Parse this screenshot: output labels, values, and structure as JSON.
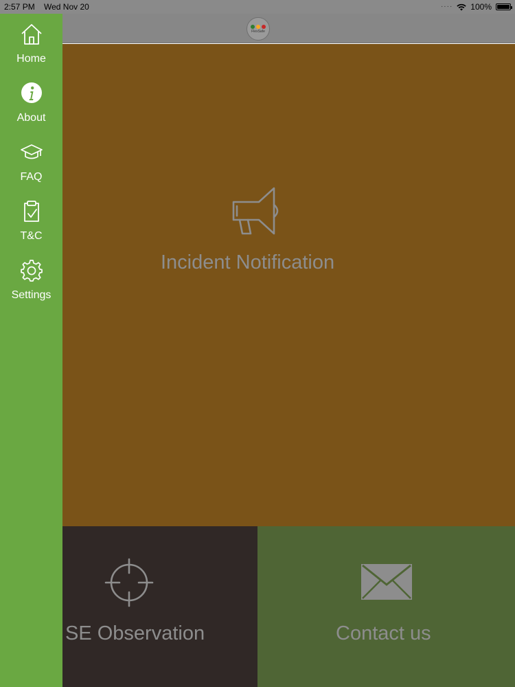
{
  "status_bar": {
    "time": "2:57 PM",
    "date": "Wed Nov 20",
    "battery": "100%",
    "signal_dots": "····"
  },
  "header": {
    "logo_text": "FlexSafe",
    "logo_colors": [
      "#2e7d32",
      "#f9a825",
      "#c62828"
    ]
  },
  "sidebar": {
    "background": "#6aa842",
    "items": [
      {
        "label": "Home",
        "icon": "home-icon"
      },
      {
        "label": "About",
        "icon": "info-icon"
      },
      {
        "label": "FAQ",
        "icon": "graduation-cap-icon"
      },
      {
        "label": "T&C",
        "icon": "clipboard-check-icon"
      },
      {
        "label": "Settings",
        "icon": "gear-icon"
      }
    ]
  },
  "tiles": {
    "incident": {
      "label": "Incident Notification",
      "icon": "megaphone-icon",
      "color": "#7a5318"
    },
    "se_observation": {
      "label": "SE Observation",
      "icon": "crosshair-icon",
      "color": "#302826"
    },
    "contact": {
      "label": "Contact us",
      "icon": "envelope-icon",
      "color": "#4f6535"
    }
  }
}
